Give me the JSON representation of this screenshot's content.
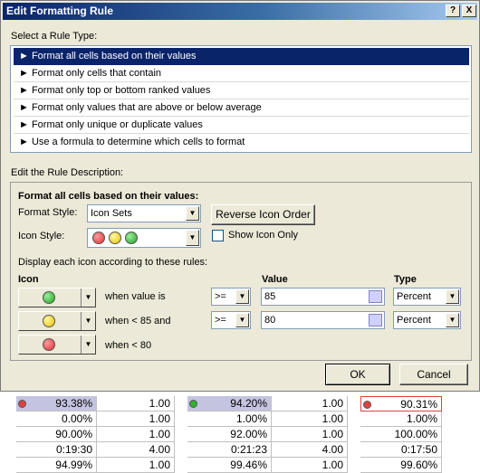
{
  "dialog": {
    "title": "Edit Formatting Rule",
    "help_label": "?",
    "close_label": "X",
    "select_rule_label": "Select a Rule Type:",
    "rule_types": [
      "► Format all cells based on their values",
      "► Format only cells that contain",
      "► Format only top or bottom ranked values",
      "► Format only values that are above or below average",
      "► Format only unique or duplicate values",
      "► Use a formula to determine which cells to format"
    ],
    "selected_rule_index": 0,
    "edit_desc_label": "Edit the Rule Description:",
    "desc_heading": "Format all cells based on their values:",
    "format_style_label": "Format Style:",
    "format_style_value": "Icon Sets",
    "reverse_icon_order_label": "Reverse Icon Order",
    "icon_style_label": "Icon Style:",
    "show_icon_only_label": "Show Icon Only",
    "show_icon_only_checked": false,
    "display_rules_label": "Display each icon according to these rules:",
    "col_icon": "Icon",
    "col_value": "Value",
    "col_type": "Type",
    "rules": [
      {
        "icon": "green-circle",
        "condition": "when value is",
        "operator": ">=",
        "value": "85",
        "type": "Percent"
      },
      {
        "icon": "yellow-circle",
        "condition": "when < 85 and",
        "operator": ">=",
        "value": "80",
        "type": "Percent"
      },
      {
        "icon": "red-circle",
        "condition": "when < 80"
      }
    ],
    "ok_label": "OK",
    "cancel_label": "Cancel"
  },
  "colors": {
    "title_bar": "#0a246a",
    "selection": "#0a246a",
    "dialog_bg": "#ece9d8",
    "cell_highlight": "#c4c4e0"
  },
  "sheet": {
    "rows": [
      [
        "93.38%",
        "1.00",
        "94.20%",
        "1.00",
        "90.31%"
      ],
      [
        "0.00%",
        "1.00",
        "1.00%",
        "1.00",
        "1.00%"
      ],
      [
        "90.00%",
        "1.00",
        "92.00%",
        "1.00",
        "100.00%"
      ],
      [
        "0:19:30",
        "4.00",
        "0:21:23",
        "4.00",
        "0:17:50"
      ],
      [
        "94.99%",
        "1.00",
        "99.46%",
        "1.00",
        "99.60%"
      ]
    ],
    "first_row_icons": [
      "red-circle",
      "green-circle",
      "red-circle"
    ]
  }
}
